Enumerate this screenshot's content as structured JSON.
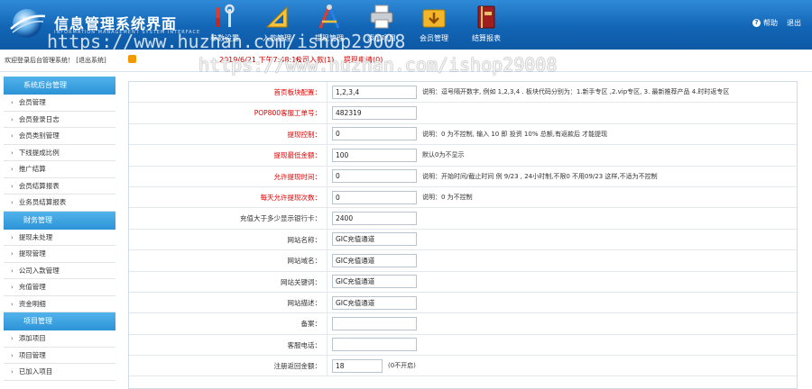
{
  "header": {
    "title": "信息管理系统界面",
    "subtitle": "INFORMATION MANAGEMENT SYSTEM INTERFACE",
    "nav": [
      {
        "label": "参数设置",
        "icon": "tools-icon"
      },
      {
        "label": "入款管理",
        "icon": "ruler-icon"
      },
      {
        "label": "提现管理",
        "icon": "compass-icon"
      },
      {
        "label": "添加项目",
        "icon": "printer-icon"
      },
      {
        "label": "会员管理",
        "icon": "folder-download-icon"
      },
      {
        "label": "结算报表",
        "icon": "book-icon"
      }
    ],
    "help": "帮助",
    "logout": "退出"
  },
  "watermark": "https://www.huzhan.com/ishop29008",
  "subbar": {
    "welcome": "欢迎登录后台管理系统！ [退出系统]",
    "datetime": "2019/6/21 下午7:48:16",
    "stat1": "公司入款(1)",
    "stat2": "提现申请(0)"
  },
  "sidebar": [
    {
      "title": "系统后台管理",
      "items": [
        "会员管理",
        "会员登录日志",
        "会员类别管理",
        "下线提成比例",
        "推广结算",
        "会员结算报表",
        "业务员结算报表"
      ]
    },
    {
      "title": "财务管理",
      "items": [
        "提现未处理",
        "提现管理",
        "公司入款管理",
        "充值管理",
        "资金明细"
      ]
    },
    {
      "title": "项目管理",
      "items": [
        "添加项目",
        "项目管理",
        "已加入项目"
      ]
    }
  ],
  "form": [
    {
      "label": "首页板块配置：",
      "red": true,
      "value": "1,2,3,4",
      "note": "说明：逗号隔开数字, 例如 1,2,3,4 . 板块代码分别为：1.新手专区 ,2.vip专区, 3. 最新推荐产品 4.时时返专区"
    },
    {
      "label": "POP800客服工单号：",
      "red": true,
      "value": "482319",
      "note": ""
    },
    {
      "label": "提现控制：",
      "red": true,
      "value": "0",
      "note": "说明：0 为不控制, 输入 10 即 投资 10% 总额,有返款后 才能提现"
    },
    {
      "label": "提现最低金额：",
      "red": true,
      "value": "100",
      "note": "默认0为不显示"
    },
    {
      "label": "允许提现时间：",
      "red": true,
      "value": "0",
      "note": "说明：开始时间/截止时间 例 9/23 , 24小时制,不限0 不用09/23 这样,不适为不控制"
    },
    {
      "label": "每天允许提现次数：",
      "red": true,
      "value": "0",
      "note": "说明：0 为不控制"
    },
    {
      "label": "充值大于多少显示银行卡：",
      "red": false,
      "value": "2400",
      "note": ""
    },
    {
      "label": "网站名称：",
      "red": false,
      "value": "GIC充值通道",
      "note": ""
    },
    {
      "label": "网站域名：",
      "red": false,
      "value": "GIC充值通道",
      "note": ""
    },
    {
      "label": "网站关键词：",
      "red": false,
      "value": "GIC充值通道",
      "note": ""
    },
    {
      "label": "网站描述：",
      "red": false,
      "value": "GIC充值通道",
      "note": ""
    },
    {
      "label": "备案：",
      "red": false,
      "value": "",
      "note": ""
    },
    {
      "label": "客服电话：",
      "red": false,
      "value": "",
      "note": ""
    },
    {
      "label": "注册返回金额：",
      "red": false,
      "value": "18",
      "note": "(0不开启)",
      "short": true
    }
  ]
}
